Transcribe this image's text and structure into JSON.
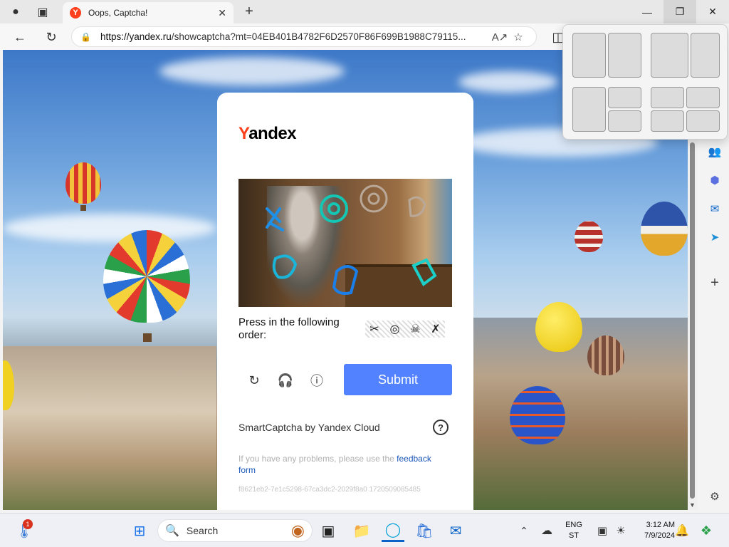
{
  "browser": {
    "tab_title": "Oops, Captcha!",
    "tab_favicon": "Y",
    "url_host": "https://yandex.ru",
    "url_path": "/showcaptcha?mt=04EB401B4782F6D2570F86F699B1988C79115..."
  },
  "captcha": {
    "logo_y": "Y",
    "logo_rest": "andex",
    "instruction": "Press in the following order:",
    "order_icons": [
      "✂",
      "◎",
      "☠",
      "✗"
    ],
    "submit_label": "Submit",
    "brand": "SmartCaptcha by Yandex Cloud",
    "help_glyph": "?",
    "problems_text": "If you have any problems, please use the ",
    "feedback_link": "feedback form",
    "request_id": "f8621eb2-7e1c5298-67ca3dc2-2029f8a0 1720509085485"
  },
  "taskbar": {
    "search_label": "Search",
    "language_top": "ENG",
    "language_bottom": "ST",
    "time": "3:12 AM",
    "date": "7/9/2024",
    "notification_count": "1"
  }
}
